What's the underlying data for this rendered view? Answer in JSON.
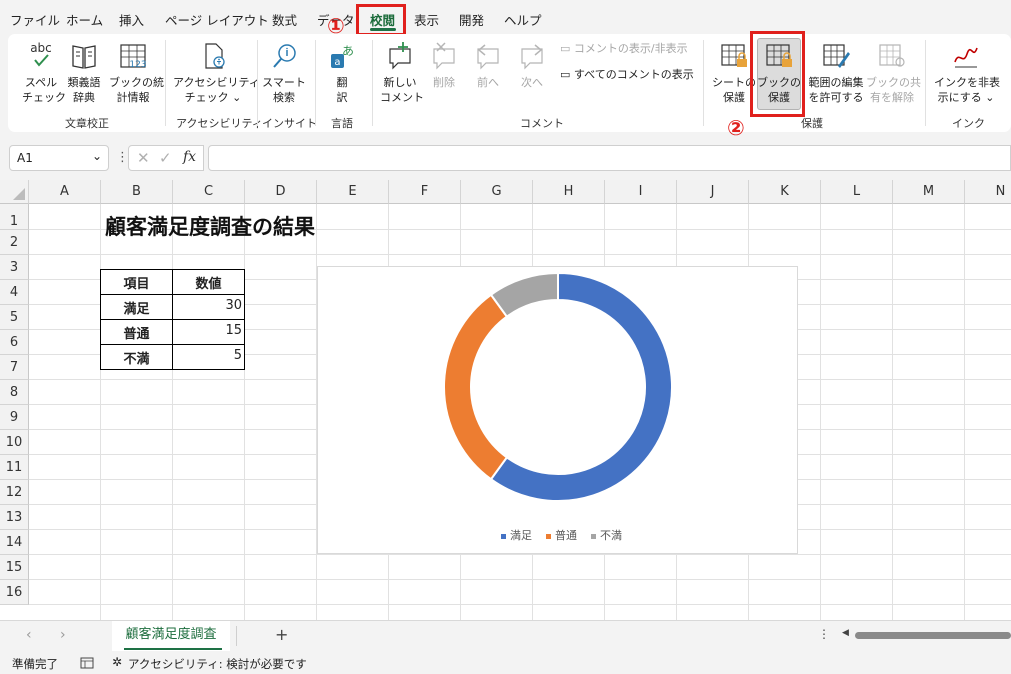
{
  "menu": {
    "tabs": [
      "ファイル",
      "ホーム",
      "挿入",
      "ページ レイアウト",
      "数式",
      "データ",
      "校閲",
      "表示",
      "開発",
      "ヘルプ"
    ],
    "active_tab": "校閲"
  },
  "annotations": {
    "step1": "①",
    "step2": "②",
    "accent_color": "#e0201c"
  },
  "ribbon": {
    "proofing": {
      "spelling_l1": "スペル",
      "spelling_l2": "チェック",
      "spelling_icon_text": "abc",
      "thesaurus_l1": "類義語",
      "thesaurus_l2": "辞典",
      "stats_l1": "ブックの統",
      "stats_l2": "計情報",
      "stats_icon_text": "123",
      "group": "文章校正"
    },
    "accessibility": {
      "check_l1": "アクセシビリティ",
      "check_l2": "チェック",
      "group": "アクセシビリティ"
    },
    "insights": {
      "smart_l1": "スマート",
      "smart_l2": "検索",
      "group": "インサイト"
    },
    "language": {
      "translate_l1": "翻",
      "translate_l2": "訳",
      "group": "言語"
    },
    "comments": {
      "new_l1": "新しい",
      "new_l2": "コメント",
      "delete": "削除",
      "prev": "前へ",
      "next": "次へ",
      "show_hide": "コメントの表示/非表示",
      "show_all": "すべてのコメントの表示",
      "group": "コメント"
    },
    "protect": {
      "sheet_l1": "シートの",
      "sheet_l2": "保護",
      "book_l1": "ブックの",
      "book_l2": "保護",
      "ranges_l1": "範囲の編集",
      "ranges_l2": "を許可する",
      "unshare_l1": "ブックの共",
      "unshare_l2": "有を解除",
      "group": "保護"
    },
    "ink": {
      "hide_l1": "インクを非表",
      "hide_l2": "示にする",
      "group": "インク"
    }
  },
  "formula_bar": {
    "name_box": "A1",
    "fx": "fx",
    "formula": ""
  },
  "grid": {
    "columns": [
      "A",
      "B",
      "C",
      "D",
      "E",
      "F",
      "G",
      "H",
      "I",
      "J",
      "K",
      "L",
      "M",
      "N"
    ],
    "rows": [
      "1",
      "2",
      "3",
      "4",
      "5",
      "6",
      "7",
      "8",
      "9",
      "10",
      "11",
      "12",
      "13",
      "14",
      "15",
      "16"
    ]
  },
  "sheet": {
    "title": "顧客満足度調査の結果",
    "table_headers": [
      "項目",
      "数値"
    ],
    "table_rows": [
      {
        "label": "満足",
        "value": "30"
      },
      {
        "label": "普通",
        "value": "15"
      },
      {
        "label": "不満",
        "value": "5"
      }
    ]
  },
  "chart_data": {
    "type": "pie",
    "subtype": "doughnut",
    "categories": [
      "満足",
      "普通",
      "不満"
    ],
    "values": [
      30,
      15,
      5
    ],
    "colors": [
      "#4472c4",
      "#ed7d31",
      "#a5a5a5"
    ],
    "title": "",
    "legend": "bottom"
  },
  "sheet_tabs": {
    "active": "顧客満足度調査",
    "add": "+"
  },
  "status": {
    "ready": "準備完了",
    "accessibility": "アクセシビリティ: 検討が必要です"
  }
}
